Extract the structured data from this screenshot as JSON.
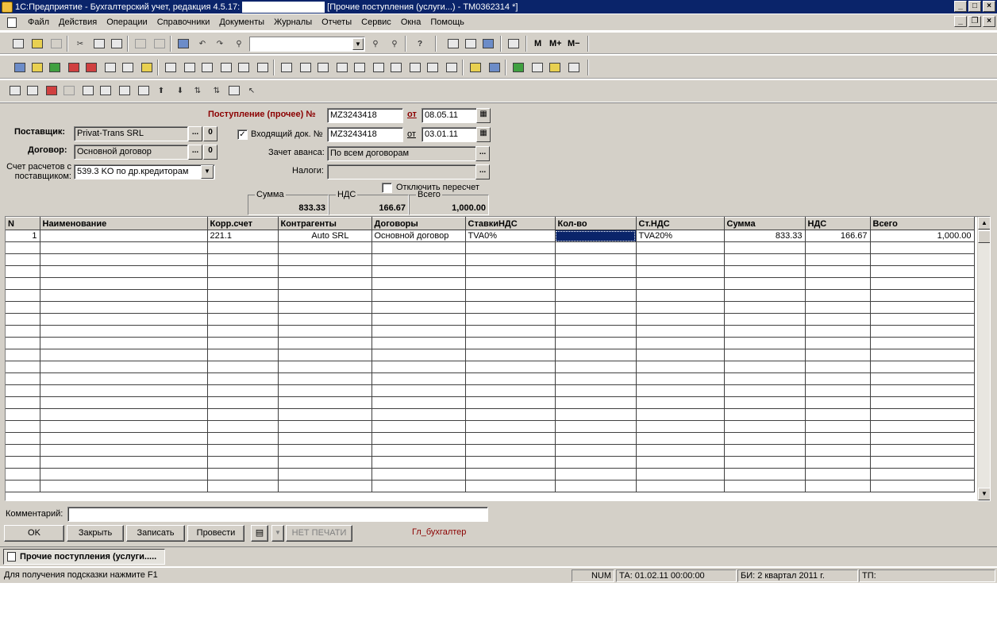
{
  "window": {
    "title_left": "1С:Предприятие - Бухгалтерский учет, редакция 4.5.17:",
    "title_right": "[Прочие поступления (услуги...) - TM0362314 *]"
  },
  "menu": {
    "items": [
      "Файл",
      "Действия",
      "Операции",
      "Справочники",
      "Документы",
      "Журналы",
      "Отчеты",
      "Сервис",
      "Окна",
      "Помощь"
    ]
  },
  "toolbar": {
    "search_value": "",
    "m_label": "M",
    "mplus_label": "M+",
    "mminus_label": "M−"
  },
  "form": {
    "doc_title": "Поступление (прочее) №",
    "doc_number": "MZ3243418",
    "from_label": "от",
    "doc_date": "08.05.11",
    "supplier_label": "Поставщик:",
    "supplier_value": "Privat-Trans SRL",
    "incoming_label": "Входящий док. №",
    "incoming_checked": "✓",
    "incoming_number": "MZ3243418",
    "incoming_date": "03.01.11",
    "contract_label": "Договор:",
    "contract_value": "Основной договор",
    "advance_label": "Зачет аванса:",
    "advance_value": "По всем договорам",
    "account_label_1": "Счет расчетов с",
    "account_label_2": "поставщиком:",
    "account_value": "539.3 KO по др.кредиторам",
    "taxes_label": "Налоги:",
    "taxes_value": "",
    "disable_recalc_label": "Отключить пересчет",
    "btn_dots": "...",
    "btn_zero": "0"
  },
  "totals": {
    "sum_label": "Сумма",
    "sum_value": "833.33",
    "vat_label": "НДС",
    "vat_value": "166.67",
    "total_label": "Всего",
    "total_value": "1,000.00"
  },
  "table": {
    "columns": [
      "N",
      "Наименование",
      "Корр.счет",
      "Контрагенты",
      "Договоры",
      "СтавкиНДС",
      "Кол-во",
      "Ст.НДС",
      "Сумма",
      "НДС",
      "Всего"
    ],
    "rows": [
      [
        "1",
        "",
        "221.1",
        "Auto SRL",
        "Основной договор",
        "TVA0%",
        "",
        "TVA20%",
        "833.33",
        "166.67",
        "1,000.00"
      ]
    ]
  },
  "bottom": {
    "comment_label": "Комментарий:",
    "comment_value": "",
    "ok": "OK",
    "close": "Закрыть",
    "save": "Записать",
    "post": "Провести",
    "no_print": "НЕТ ПЕЧАТИ",
    "user": "Гл_бухгалтер"
  },
  "tasktab": {
    "label": "Прочие поступления (услуги....."
  },
  "status": {
    "hint": "Для получения подсказки нажмите F1",
    "num": "NUM",
    "ta": "ТА: 01.02.11  00:00:00",
    "bi": "БИ: 2 квартал 2011 г.",
    "tp": "ТП:"
  }
}
